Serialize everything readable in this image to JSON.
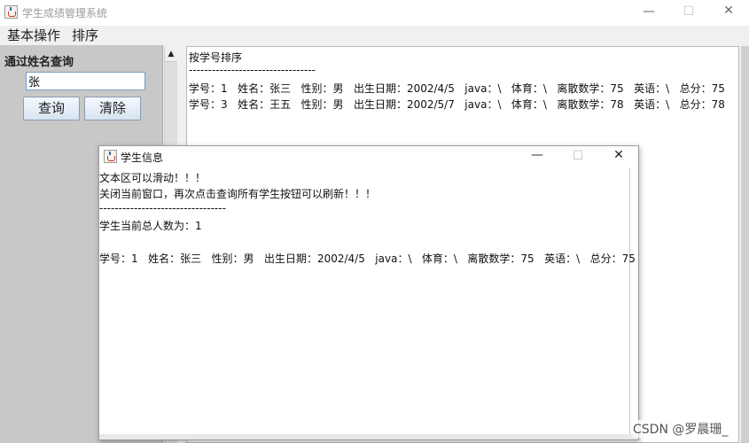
{
  "main_window": {
    "title": "学生成绩管理系统",
    "controls": {
      "minimize": "—",
      "maximize": "☐",
      "close": "✕"
    }
  },
  "menubar": {
    "items": [
      "基本操作",
      "排序"
    ]
  },
  "left_panel": {
    "search_label": "通过姓名查询",
    "search_value": "张",
    "query_button": "查询",
    "clear_button": "清除"
  },
  "text_area": {
    "lines": [
      "按学号排序",
      "---------------------------------",
      "学号：1   姓名：张三   性别：男   出生日期：2002/4/5   java：\\   体育：\\   离散数学：75   英语：\\   总分：75",
      "学号：3   姓名：王五   性别：男   出生日期：2002/5/7   java：\\   体育：\\   离散数学：78   英语：\\   总分：78"
    ]
  },
  "dialog": {
    "title": "学生信息",
    "controls": {
      "minimize": "—",
      "maximize": "☐",
      "close": "✕"
    },
    "lines": [
      "文本区可以滑动！！！",
      "关闭当前窗口，再次点击查询所有学生按钮可以刷新！！！",
      "---------------------------------",
      "学生当前总人数为：1",
      "",
      "学号：1   姓名：张三   性别：男   出生日期：2002/4/5   java：\\   体育：\\   离散数学：75   英语：\\   总分：75"
    ]
  },
  "watermark": "CSDN @罗晨珊_"
}
